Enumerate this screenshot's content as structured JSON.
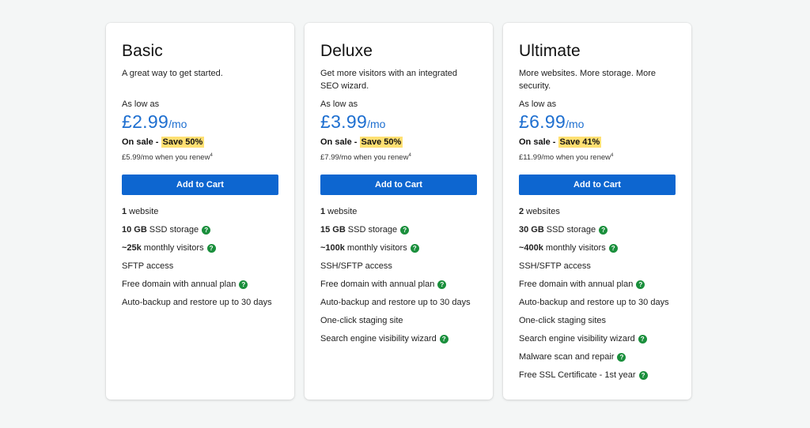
{
  "plans": [
    {
      "title": "Basic",
      "description": "A great way to get started.",
      "as_low_as": "As low as",
      "price": "£2.99",
      "per": "/mo",
      "sale_prefix": "On sale - ",
      "save": "Save 50%",
      "renew": "£5.99/mo when you renew",
      "renew_sup": "4",
      "cart_label": "Add to Cart",
      "features": [
        {
          "strong": "1",
          "text": "website",
          "help": false
        },
        {
          "strong": "10 GB",
          "text": "SSD storage",
          "help": true
        },
        {
          "strong": "~25k",
          "text": "monthly visitors",
          "help": true
        },
        {
          "strong": "",
          "text": "SFTP access",
          "help": false
        },
        {
          "strong": "",
          "text": "Free domain with annual plan",
          "help": true
        },
        {
          "strong": "",
          "text": "Auto-backup and restore up to 30 days",
          "help": false
        }
      ]
    },
    {
      "title": "Deluxe",
      "description": "Get more visitors with an integrated SEO wizard.",
      "as_low_as": "As low as",
      "price": "£3.99",
      "per": "/mo",
      "sale_prefix": "On sale - ",
      "save": "Save 50%",
      "renew": "£7.99/mo when you renew",
      "renew_sup": "4",
      "cart_label": "Add to Cart",
      "features": [
        {
          "strong": "1",
          "text": "website",
          "help": false
        },
        {
          "strong": "15 GB",
          "text": "SSD storage",
          "help": true
        },
        {
          "strong": "~100k",
          "text": "monthly visitors",
          "help": true
        },
        {
          "strong": "",
          "text": "SSH/SFTP access",
          "help": false
        },
        {
          "strong": "",
          "text": "Free domain with annual plan",
          "help": true
        },
        {
          "strong": "",
          "text": "Auto-backup and restore up to 30 days",
          "help": false
        },
        {
          "strong": "",
          "text": "One-click staging site",
          "help": false
        },
        {
          "strong": "",
          "text": "Search engine visibility wizard",
          "help": true
        }
      ]
    },
    {
      "title": "Ultimate",
      "description": "More websites. More storage. More security.",
      "as_low_as": "As low as",
      "price": "£6.99",
      "per": "/mo",
      "sale_prefix": "On sale - ",
      "save": "Save 41%",
      "renew": "£11.99/mo when you renew",
      "renew_sup": "4",
      "cart_label": "Add to Cart",
      "features": [
        {
          "strong": "2",
          "text": "websites",
          "help": false
        },
        {
          "strong": "30 GB",
          "text": "SSD storage",
          "help": true
        },
        {
          "strong": "~400k",
          "text": "monthly visitors",
          "help": true
        },
        {
          "strong": "",
          "text": "SSH/SFTP access",
          "help": false
        },
        {
          "strong": "",
          "text": "Free domain with annual plan",
          "help": true
        },
        {
          "strong": "",
          "text": "Auto-backup and restore up to 30 days",
          "help": false
        },
        {
          "strong": "",
          "text": "One-click staging sites",
          "help": false
        },
        {
          "strong": "",
          "text": "Search engine visibility wizard",
          "help": true
        },
        {
          "strong": "",
          "text": "Malware scan and repair",
          "help": true
        },
        {
          "strong": "",
          "text": "Free SSL Certificate - 1st year",
          "help": true
        }
      ]
    }
  ],
  "help_icon": "question-mark-icon",
  "help_glyph": "?",
  "colors": {
    "accent": "#0d66d0",
    "price": "#1e6fd0",
    "save_highlight": "#ffe072",
    "help_icon": "#1a8f3c",
    "background": "#f4f6f6"
  }
}
